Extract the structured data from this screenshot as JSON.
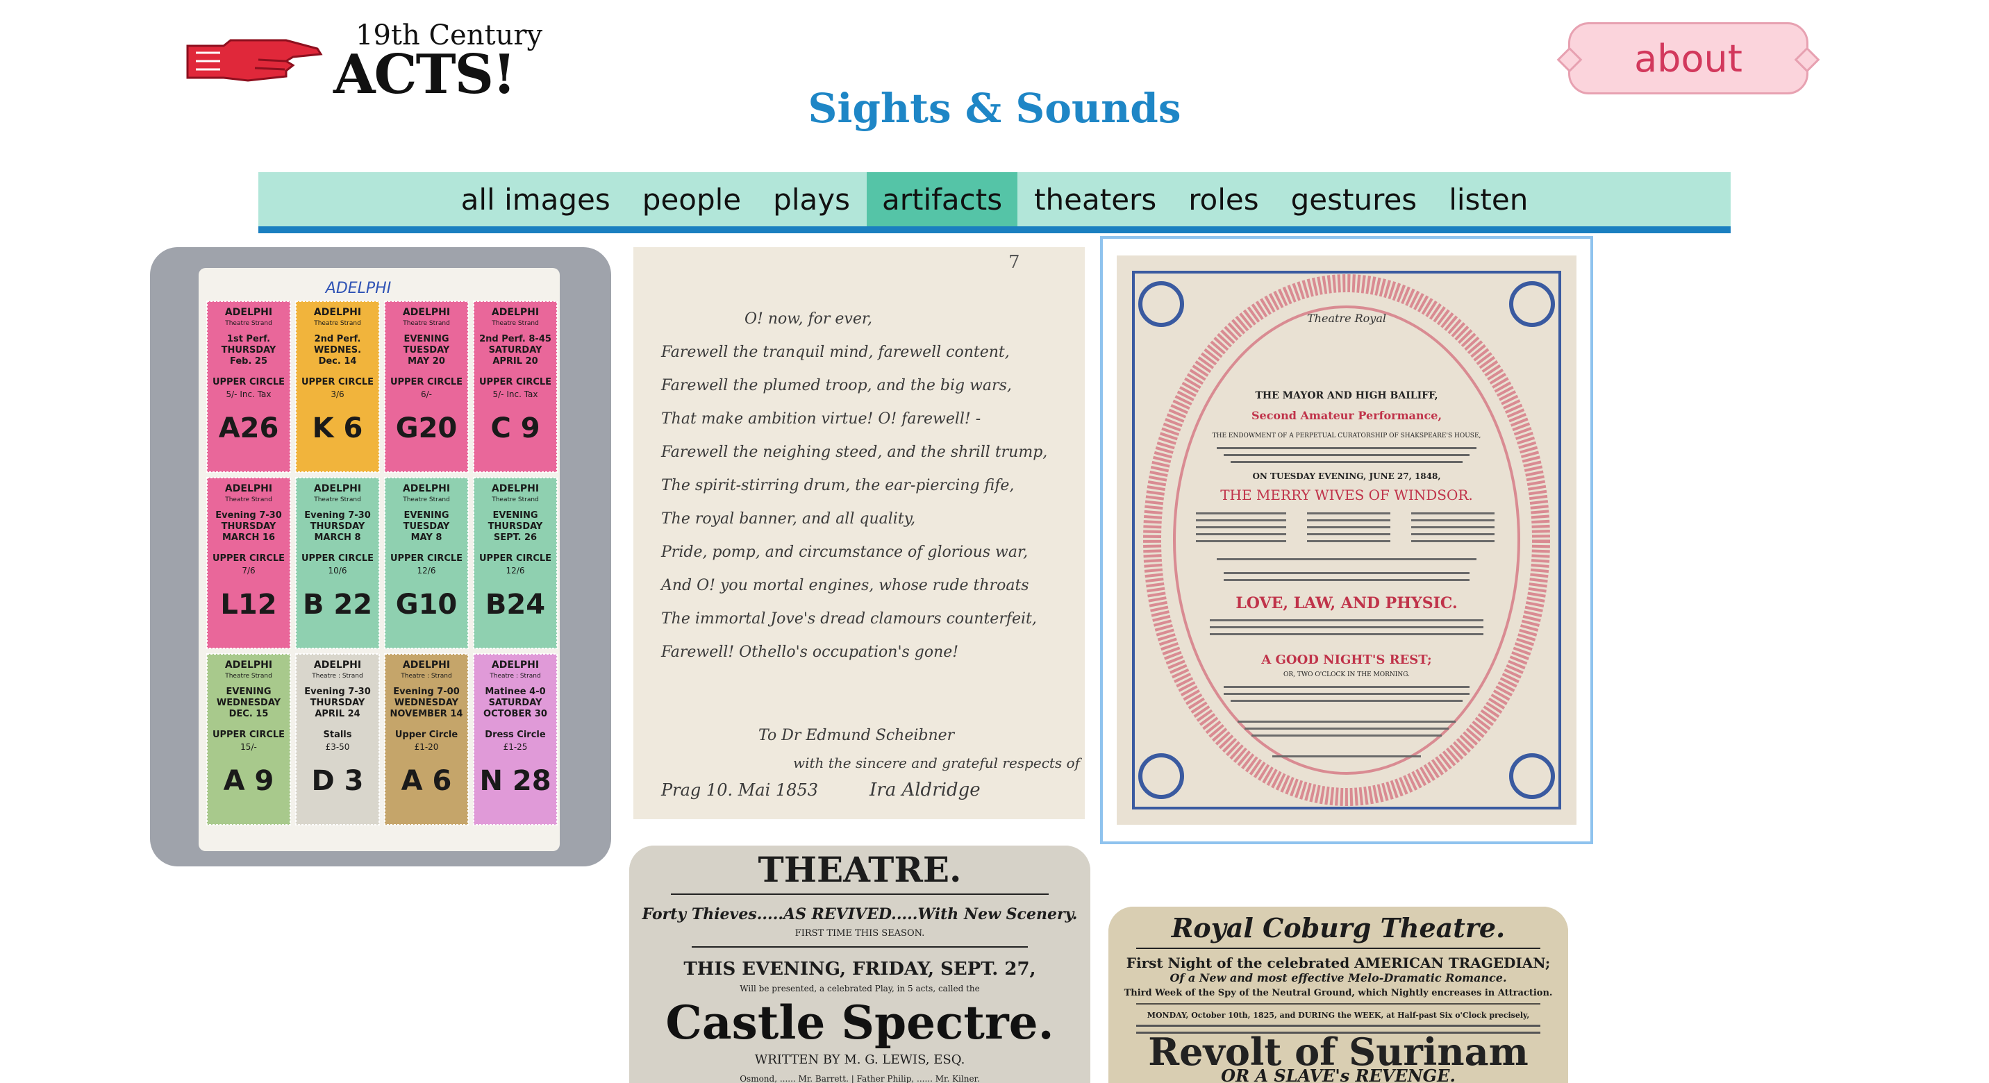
{
  "brand": {
    "logo_superscript": "19th Century",
    "logo_main": "ACTS!"
  },
  "header": {
    "about_label": "about",
    "title": "Sights & Sounds"
  },
  "nav": {
    "items": [
      "all images",
      "people",
      "plays",
      "artifacts",
      "theaters",
      "roles",
      "gestures",
      "listen"
    ],
    "active": "artifacts"
  },
  "colors": {
    "accent_blue": "#1e86c6",
    "nav_bg": "#b2e6d9",
    "nav_active": "#55c4a7",
    "about_pink": "#fbd4dc"
  },
  "gallery": {
    "tickets": {
      "header": "ADELPHI",
      "stubs": [
        {
          "theatre": "ADELPHI",
          "venue": "Theatre Strand",
          "perf": "1st Perf.",
          "day": "THURSDAY",
          "date": "Feb. 25",
          "section": "UPPER CIRCLE",
          "price": "5/- Inc. Tax",
          "seat": "A26",
          "color": "#e9679a"
        },
        {
          "theatre": "ADELPHI",
          "venue": "Theatre Strand",
          "perf": "2nd Perf.",
          "day": "WEDNES.",
          "date": "Dec. 14",
          "section": "UPPER CIRCLE",
          "price": "3/6",
          "seat": "K 6",
          "color": "#f1b43c"
        },
        {
          "theatre": "ADELPHI",
          "venue": "Theatre Strand",
          "perf": "EVENING",
          "day": "TUESDAY",
          "date": "MAY 20",
          "section": "UPPER CIRCLE",
          "price": "6/-",
          "seat": "G20",
          "color": "#e9679a"
        },
        {
          "theatre": "ADELPHI",
          "venue": "Theatre Strand",
          "perf": "2nd Perf. 8-45",
          "day": "SATURDAY",
          "date": "APRIL 20",
          "section": "UPPER CIRCLE",
          "price": "5/- Inc. Tax",
          "seat": "C 9",
          "color": "#e9679a"
        },
        {
          "theatre": "ADELPHI",
          "venue": "Theatre Strand",
          "perf": "Evening 7-30",
          "day": "THURSDAY",
          "date": "MARCH 16",
          "section": "UPPER CIRCLE",
          "price": "7/6",
          "seat": "L12",
          "color": "#e9679a"
        },
        {
          "theatre": "ADELPHI",
          "venue": "Theatre Strand",
          "perf": "Evening 7-30",
          "day": "THURSDAY",
          "date": "MARCH 8",
          "section": "UPPER CIRCLE",
          "price": "10/6",
          "seat": "B 22",
          "color": "#8fd0b0"
        },
        {
          "theatre": "ADELPHI",
          "venue": "Theatre Strand",
          "perf": "EVENING",
          "day": "TUESDAY",
          "date": "MAY 8",
          "section": "UPPER CIRCLE",
          "price": "12/6",
          "seat": "G10",
          "color": "#8fd0b0"
        },
        {
          "theatre": "ADELPHI",
          "venue": "Theatre Strand",
          "perf": "EVENING",
          "day": "THURSDAY",
          "date": "SEPT. 26",
          "section": "UPPER CIRCLE",
          "price": "12/6",
          "seat": "B24",
          "color": "#8fd0b0"
        },
        {
          "theatre": "ADELPHI",
          "venue": "Theatre Strand",
          "perf": "EVENING",
          "day": "WEDNESDAY",
          "date": "DEC. 15",
          "section": "UPPER CIRCLE",
          "price": "15/-",
          "seat": "A 9",
          "color": "#a8c98c"
        },
        {
          "theatre": "ADELPHI",
          "venue": "Theatre : Strand",
          "perf": "Evening 7-30",
          "day": "THURSDAY",
          "date": "APRIL 24",
          "section": "Stalls",
          "price": "£3-50",
          "seat": "D 3",
          "color": "#d9d6cc"
        },
        {
          "theatre": "ADELPHI",
          "venue": "Theatre : Strand",
          "perf": "Evening 7-00",
          "day": "WEDNESDAY",
          "date": "NOVEMBER 14",
          "section": "Upper Circle",
          "price": "£1-20",
          "seat": "A 6",
          "color": "#c5a56a"
        },
        {
          "theatre": "ADELPHI",
          "venue": "Theatre : Strand",
          "perf": "Matinee 4-0",
          "day": "SATURDAY",
          "date": "OCTOBER 30",
          "section": "Dress Circle",
          "price": "£1-25",
          "seat": "N 28",
          "color": "#e09ad8"
        }
      ]
    },
    "letter": {
      "page_number": "7",
      "lines": [
        "O! now, for ever,",
        "Farewell the tranquil mind, farewell content,",
        "Farewell the plumed troop, and the big wars,",
        "That make ambition virtue! O! farewell! -",
        "Farewell the neighing steed, and the shrill trump,",
        "The spirit-stirring drum, the ear-piercing fife,",
        "The royal banner, and all quality,",
        "Pride, pomp, and circumstance of glorious war,",
        "And O! you mortal engines, whose rude throats",
        "The immortal Jove's dread clamours counterfeit,",
        "Farewell! Othello's occupation's gone!"
      ],
      "dedication": "To Dr Edmund Scheibner",
      "regards": "with the sincere and grateful respects of",
      "place_date": "Prag 10. Mai 1853",
      "signature": "Ira Aldridge"
    },
    "playbill": {
      "heading": "Theatre Royal",
      "patrons": "THE MAYOR AND HIGH BAILIFF,",
      "title": "Second Amateur Performance,",
      "subject": "THE ENDOWMENT OF A PERPETUAL CURATORSHIP OF SHAKSPEARE'S HOUSE,",
      "date": "ON TUESDAY EVENING, JUNE 27, 1848,",
      "play": "THE MERRY WIVES OF WINDSOR.",
      "afterpiece": "LOVE, LAW, AND PHYSIC.",
      "farce": "A GOOD NIGHT'S REST;",
      "farce_sub": "OR, TWO O'CLOCK IN THE MORNING."
    },
    "castle": {
      "heading": "THEATRE.",
      "line1": "Forty Thieves.....AS REVIVED.....With New Scenery.",
      "line2": "FIRST TIME THIS SEASON.",
      "line3": "THIS EVENING, FRIDAY, SEPT. 27,",
      "line4": "Will be presented, a celebrated Play, in 5 acts, called the",
      "title": "Castle Spectre.",
      "author": "WRITTEN BY M. G. LEWIS, ESQ.",
      "cast": "Osmond, ...... Mr. Barrett. | Father Philip, ...... Mr. Kilner."
    },
    "coburg": {
      "heading": "Royal Coburg Theatre.",
      "line1": "First Night of the celebrated AMERICAN TRAGEDIAN;",
      "line2": "Of a New and most effective Melo-Dramatic Romance.",
      "line3": "Third Week of the Spy of the Neutral Ground, which Nightly encreases in Attraction.",
      "line4": "MONDAY, October 10th, 1825, and DURING the WEEK, at Half-past Six o'Clock precisely,",
      "title": "Revolt of Surinam",
      "subtitle": "OR A SLAVE's REVENGE."
    }
  }
}
